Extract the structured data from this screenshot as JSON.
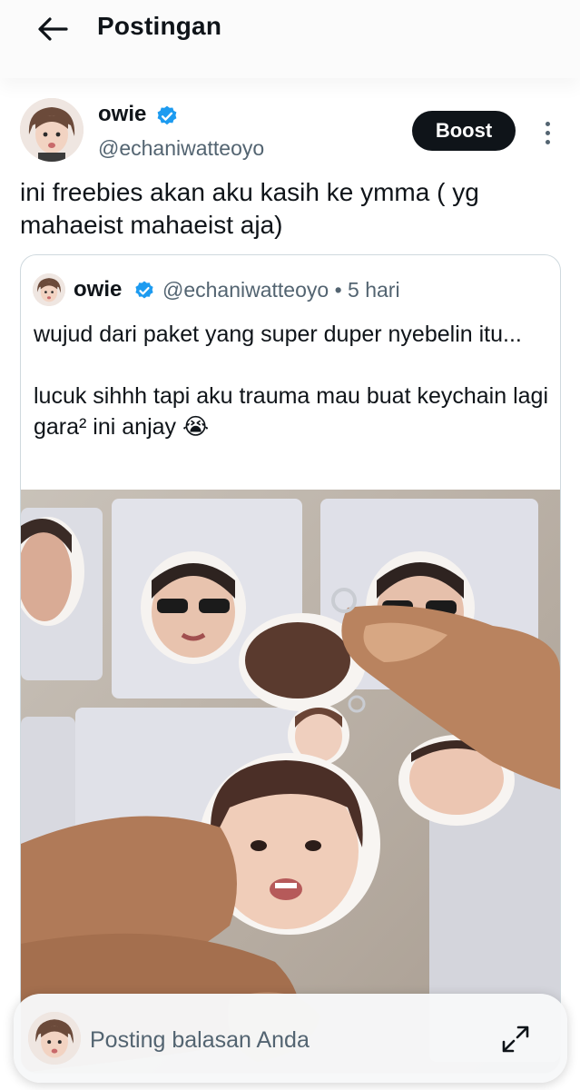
{
  "header": {
    "title": "Postingan",
    "back_icon": "arrow-left-icon"
  },
  "post": {
    "author_name": "owie",
    "author_handle": "@echaniwatteoyo",
    "verified_icon": "verified-badge-icon",
    "boost_label": "Boost",
    "more_icon": "more-vertical-icon",
    "text": "ini freebies akan aku kasih ke ymma ( yg mahaeist mahaeist aja)"
  },
  "quoted_post": {
    "author_name": "owie",
    "author_handle": "@echaniwatteoyo",
    "separator": "•",
    "time": "5 hari",
    "text": "wujud dari paket yang super duper nyebelin itu...\n\nlucuk sihhh tapi aku trauma mau buat keychain lagi gara² ini anjay 😭",
    "media_description_icon": "photo-icon"
  },
  "reply": {
    "placeholder": "Posting balasan Anda",
    "expand_icon": "expand-icon"
  },
  "colors": {
    "text_primary": "#0f1419",
    "text_secondary": "#536471",
    "verified_blue": "#1d9bf0",
    "boost_bg": "#0f1419",
    "border": "#cfd9de"
  }
}
